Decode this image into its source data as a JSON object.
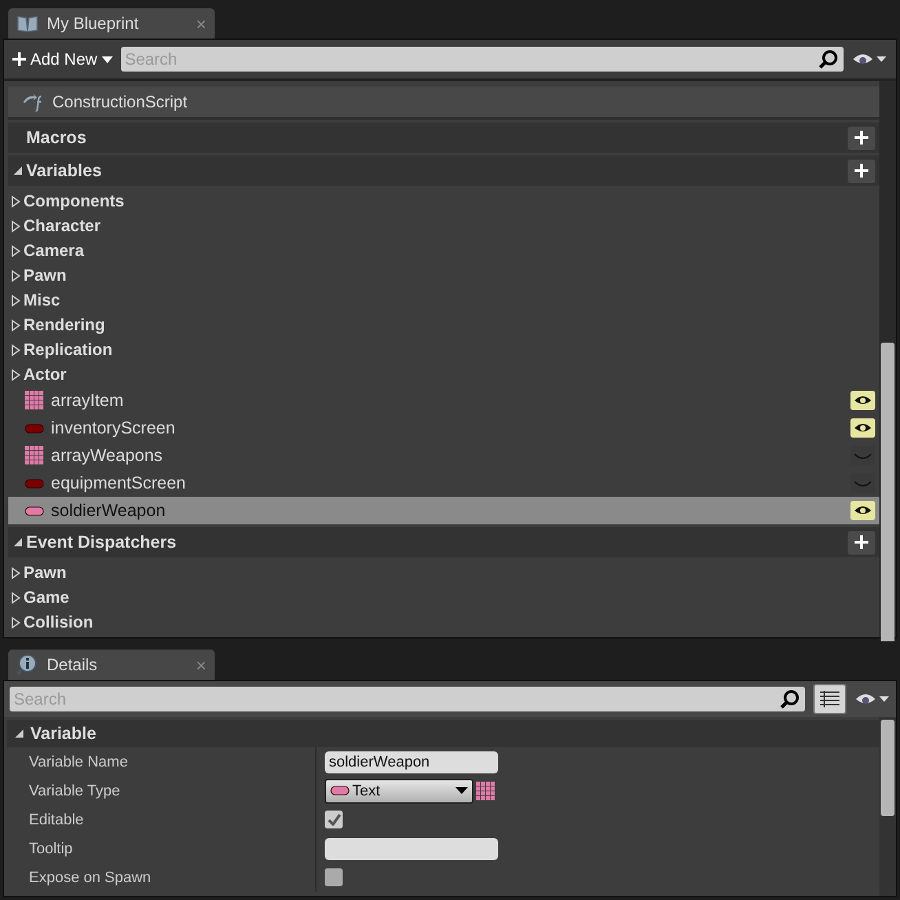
{
  "blueprint_panel": {
    "tab": {
      "title": "My Blueprint",
      "close": "×"
    },
    "toolbar": {
      "add_button": "Add New",
      "search": {
        "placeholder": "Search"
      }
    },
    "functions": [
      {
        "name": "ConstructionScript"
      }
    ],
    "sections": [
      {
        "title": "Macros",
        "expanded": false
      },
      {
        "title": "Variables",
        "expanded": true,
        "categories": [
          {
            "label": "Components",
            "expanded": false
          },
          {
            "label": "Character",
            "expanded": false
          },
          {
            "label": "Camera",
            "expanded": false
          },
          {
            "label": "Pawn",
            "expanded": false
          },
          {
            "label": "Misc",
            "expanded": false
          },
          {
            "label": "Rendering",
            "expanded": false
          },
          {
            "label": "Replication",
            "expanded": false
          },
          {
            "label": "Actor",
            "expanded": false
          }
        ],
        "variables": [
          {
            "name": "arrayItem",
            "kind": "array",
            "color": "#e07aa8",
            "public": true,
            "selected": false
          },
          {
            "name": "inventoryScreen",
            "kind": "single",
            "color": "#7a0000",
            "public": true,
            "selected": false
          },
          {
            "name": "arrayWeapons",
            "kind": "array",
            "color": "#e07aa8",
            "public": false,
            "selected": false
          },
          {
            "name": "equipmentScreen",
            "kind": "single",
            "color": "#7a0000",
            "public": false,
            "selected": false
          },
          {
            "name": "soldierWeapon",
            "kind": "single",
            "color": "#e07aa8",
            "public": true,
            "selected": true
          }
        ]
      },
      {
        "title": "Event Dispatchers",
        "expanded": true,
        "categories": [
          {
            "label": "Pawn",
            "expanded": false
          },
          {
            "label": "Game",
            "expanded": false
          },
          {
            "label": "Collision",
            "expanded": false
          }
        ]
      }
    ]
  },
  "details_panel": {
    "tab": {
      "title": "Details",
      "close": "×"
    },
    "search": {
      "placeholder": "Search"
    },
    "section": {
      "title": "Variable",
      "expanded": true
    },
    "rows": [
      {
        "label": "Variable Name",
        "kind": "text",
        "value": "soldierWeapon"
      },
      {
        "label": "Variable Type",
        "kind": "type",
        "value": "Text",
        "color": "#e07aa8"
      },
      {
        "label": "Editable",
        "kind": "checkbox",
        "checked": true
      },
      {
        "label": "Tooltip",
        "kind": "text"
      },
      {
        "label": "Expose on Spawn",
        "kind": "checkbox",
        "checked": false
      }
    ]
  }
}
